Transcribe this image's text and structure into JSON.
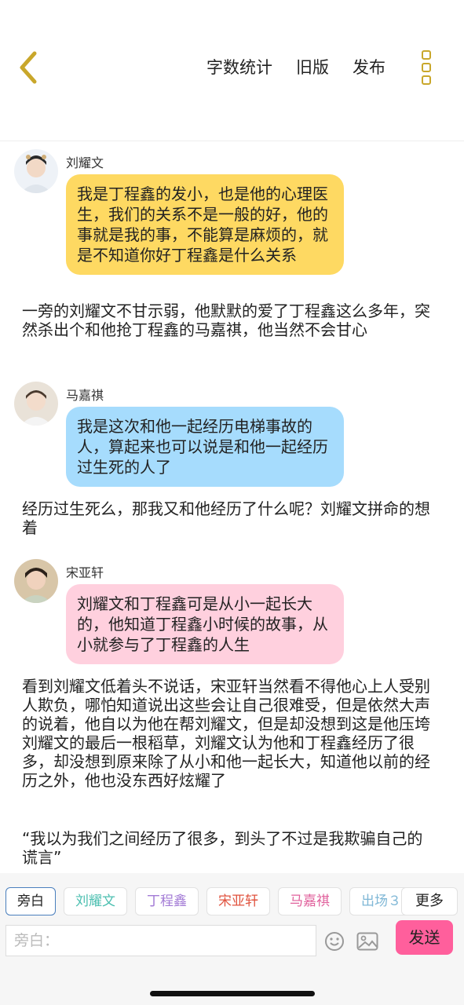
{
  "header": {
    "word_count": "字数统计",
    "old_version": "旧版",
    "publish": "发布"
  },
  "messages": [
    {
      "name": "刘耀文",
      "text": "我是丁程鑫的发小，也是他的心理医生，我们的关系不是一般的好，他的事就是我的事，不能算是麻烦的，就是不知道你好丁程鑫是什么关系",
      "color": "#fed962"
    },
    {
      "name": "马嘉祺",
      "text": "我是这次和他一起经历电梯事故的人，算起来也可以说是和他一起经历过生死的人了",
      "color": "#a6dcfd"
    },
    {
      "name": "宋亚轩",
      "text": "刘耀文和丁程鑫可是从小一起长大的，他知道丁程鑫小时候的故事，从小就参与了丁程鑫的人生",
      "color": "#ffd0de"
    }
  ],
  "narration": [
    "一旁的刘耀文不甘示弱，他默默的爱了丁程鑫这么多年，突然杀出个和他抢丁程鑫的马嘉祺，他当然不会甘心",
    "经历过生死么，那我又和他经历了什么呢？刘耀文拼命的想着",
    "看到刘耀文低着头不说话，宋亚轩当然看不得他心上人受别人欺负，哪怕知道说出这些会让自己很难受，但是依然大声的说着，他自以为他在帮刘耀文，但是却没想到这是他压垮刘耀文的最后一根稻草，刘耀文认为他和丁程鑫经历了很多，却没想到原来除了从小和他一起长大，知道他以前的经历之外，他也没东西好炫耀了",
    "“我以为我们之间经历了很多，到头了不过是我欺骗自己的谎言”"
  ],
  "roles": [
    {
      "label": "旁白",
      "color": "#222222"
    },
    {
      "label": "刘耀文",
      "color": "#4bbfb0"
    },
    {
      "label": "丁程鑫",
      "color": "#a37bd6"
    },
    {
      "label": "宋亚轩",
      "color": "#e0533f"
    },
    {
      "label": "马嘉祺",
      "color": "#e05f9b"
    },
    {
      "label": "出场３",
      "color": "#7fb7d6"
    }
  ],
  "roles_more": "更多",
  "input": {
    "placeholder": "旁白："
  },
  "send": "发送"
}
